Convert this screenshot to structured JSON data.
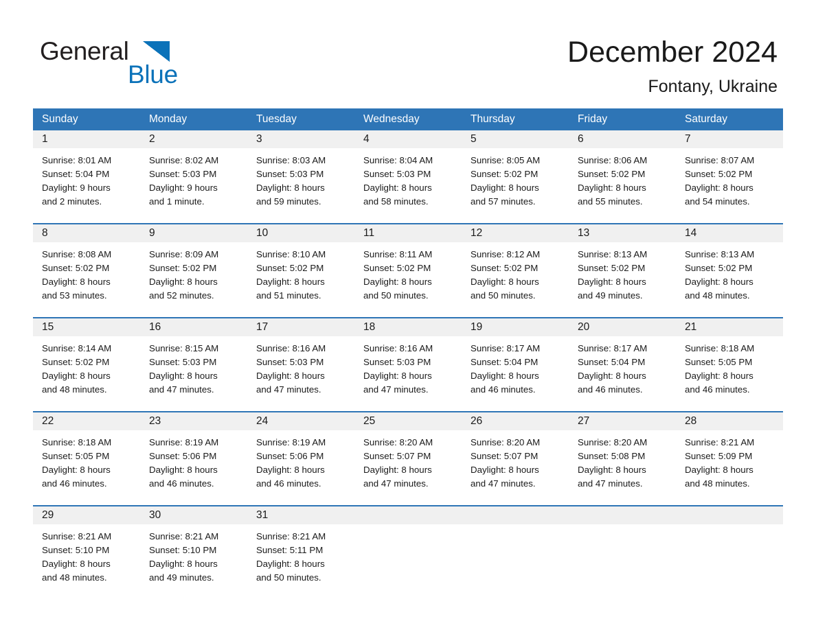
{
  "brand": {
    "name_part1": "General",
    "name_part2": "Blue",
    "triangle_icon": "blue-triangle-icon",
    "accent_color": "#0b72b9"
  },
  "header": {
    "title": "December 2024",
    "location": "Fontany, Ukraine"
  },
  "theme": {
    "header_band": "#2e75b6",
    "daynum_band": "#f0f0f0",
    "separator": "#2e75b6",
    "text": "#1a1a1a",
    "page_background": "#ffffff"
  },
  "calendar": {
    "weekday_headers": [
      "Sunday",
      "Monday",
      "Tuesday",
      "Wednesday",
      "Thursday",
      "Friday",
      "Saturday"
    ],
    "labels": {
      "sunrise_prefix": "Sunrise:",
      "sunset_prefix": "Sunset:",
      "daylight_prefix": "Daylight:"
    },
    "weeks": [
      {
        "days": [
          {
            "day": "1",
            "sunrise": "Sunrise: 8:01 AM",
            "sunset": "Sunset: 5:04 PM",
            "daylight_line1": "Daylight: 9 hours",
            "daylight_line2": "and 2 minutes."
          },
          {
            "day": "2",
            "sunrise": "Sunrise: 8:02 AM",
            "sunset": "Sunset: 5:03 PM",
            "daylight_line1": "Daylight: 9 hours",
            "daylight_line2": "and 1 minute."
          },
          {
            "day": "3",
            "sunrise": "Sunrise: 8:03 AM",
            "sunset": "Sunset: 5:03 PM",
            "daylight_line1": "Daylight: 8 hours",
            "daylight_line2": "and 59 minutes."
          },
          {
            "day": "4",
            "sunrise": "Sunrise: 8:04 AM",
            "sunset": "Sunset: 5:03 PM",
            "daylight_line1": "Daylight: 8 hours",
            "daylight_line2": "and 58 minutes."
          },
          {
            "day": "5",
            "sunrise": "Sunrise: 8:05 AM",
            "sunset": "Sunset: 5:02 PM",
            "daylight_line1": "Daylight: 8 hours",
            "daylight_line2": "and 57 minutes."
          },
          {
            "day": "6",
            "sunrise": "Sunrise: 8:06 AM",
            "sunset": "Sunset: 5:02 PM",
            "daylight_line1": "Daylight: 8 hours",
            "daylight_line2": "and 55 minutes."
          },
          {
            "day": "7",
            "sunrise": "Sunrise: 8:07 AM",
            "sunset": "Sunset: 5:02 PM",
            "daylight_line1": "Daylight: 8 hours",
            "daylight_line2": "and 54 minutes."
          }
        ]
      },
      {
        "days": [
          {
            "day": "8",
            "sunrise": "Sunrise: 8:08 AM",
            "sunset": "Sunset: 5:02 PM",
            "daylight_line1": "Daylight: 8 hours",
            "daylight_line2": "and 53 minutes."
          },
          {
            "day": "9",
            "sunrise": "Sunrise: 8:09 AM",
            "sunset": "Sunset: 5:02 PM",
            "daylight_line1": "Daylight: 8 hours",
            "daylight_line2": "and 52 minutes."
          },
          {
            "day": "10",
            "sunrise": "Sunrise: 8:10 AM",
            "sunset": "Sunset: 5:02 PM",
            "daylight_line1": "Daylight: 8 hours",
            "daylight_line2": "and 51 minutes."
          },
          {
            "day": "11",
            "sunrise": "Sunrise: 8:11 AM",
            "sunset": "Sunset: 5:02 PM",
            "daylight_line1": "Daylight: 8 hours",
            "daylight_line2": "and 50 minutes."
          },
          {
            "day": "12",
            "sunrise": "Sunrise: 8:12 AM",
            "sunset": "Sunset: 5:02 PM",
            "daylight_line1": "Daylight: 8 hours",
            "daylight_line2": "and 50 minutes."
          },
          {
            "day": "13",
            "sunrise": "Sunrise: 8:13 AM",
            "sunset": "Sunset: 5:02 PM",
            "daylight_line1": "Daylight: 8 hours",
            "daylight_line2": "and 49 minutes."
          },
          {
            "day": "14",
            "sunrise": "Sunrise: 8:13 AM",
            "sunset": "Sunset: 5:02 PM",
            "daylight_line1": "Daylight: 8 hours",
            "daylight_line2": "and 48 minutes."
          }
        ]
      },
      {
        "days": [
          {
            "day": "15",
            "sunrise": "Sunrise: 8:14 AM",
            "sunset": "Sunset: 5:02 PM",
            "daylight_line1": "Daylight: 8 hours",
            "daylight_line2": "and 48 minutes."
          },
          {
            "day": "16",
            "sunrise": "Sunrise: 8:15 AM",
            "sunset": "Sunset: 5:03 PM",
            "daylight_line1": "Daylight: 8 hours",
            "daylight_line2": "and 47 minutes."
          },
          {
            "day": "17",
            "sunrise": "Sunrise: 8:16 AM",
            "sunset": "Sunset: 5:03 PM",
            "daylight_line1": "Daylight: 8 hours",
            "daylight_line2": "and 47 minutes."
          },
          {
            "day": "18",
            "sunrise": "Sunrise: 8:16 AM",
            "sunset": "Sunset: 5:03 PM",
            "daylight_line1": "Daylight: 8 hours",
            "daylight_line2": "and 47 minutes."
          },
          {
            "day": "19",
            "sunrise": "Sunrise: 8:17 AM",
            "sunset": "Sunset: 5:04 PM",
            "daylight_line1": "Daylight: 8 hours",
            "daylight_line2": "and 46 minutes."
          },
          {
            "day": "20",
            "sunrise": "Sunrise: 8:17 AM",
            "sunset": "Sunset: 5:04 PM",
            "daylight_line1": "Daylight: 8 hours",
            "daylight_line2": "and 46 minutes."
          },
          {
            "day": "21",
            "sunrise": "Sunrise: 8:18 AM",
            "sunset": "Sunset: 5:05 PM",
            "daylight_line1": "Daylight: 8 hours",
            "daylight_line2": "and 46 minutes."
          }
        ]
      },
      {
        "days": [
          {
            "day": "22",
            "sunrise": "Sunrise: 8:18 AM",
            "sunset": "Sunset: 5:05 PM",
            "daylight_line1": "Daylight: 8 hours",
            "daylight_line2": "and 46 minutes."
          },
          {
            "day": "23",
            "sunrise": "Sunrise: 8:19 AM",
            "sunset": "Sunset: 5:06 PM",
            "daylight_line1": "Daylight: 8 hours",
            "daylight_line2": "and 46 minutes."
          },
          {
            "day": "24",
            "sunrise": "Sunrise: 8:19 AM",
            "sunset": "Sunset: 5:06 PM",
            "daylight_line1": "Daylight: 8 hours",
            "daylight_line2": "and 46 minutes."
          },
          {
            "day": "25",
            "sunrise": "Sunrise: 8:20 AM",
            "sunset": "Sunset: 5:07 PM",
            "daylight_line1": "Daylight: 8 hours",
            "daylight_line2": "and 47 minutes."
          },
          {
            "day": "26",
            "sunrise": "Sunrise: 8:20 AM",
            "sunset": "Sunset: 5:07 PM",
            "daylight_line1": "Daylight: 8 hours",
            "daylight_line2": "and 47 minutes."
          },
          {
            "day": "27",
            "sunrise": "Sunrise: 8:20 AM",
            "sunset": "Sunset: 5:08 PM",
            "daylight_line1": "Daylight: 8 hours",
            "daylight_line2": "and 47 minutes."
          },
          {
            "day": "28",
            "sunrise": "Sunrise: 8:21 AM",
            "sunset": "Sunset: 5:09 PM",
            "daylight_line1": "Daylight: 8 hours",
            "daylight_line2": "and 48 minutes."
          }
        ]
      },
      {
        "days": [
          {
            "day": "29",
            "sunrise": "Sunrise: 8:21 AM",
            "sunset": "Sunset: 5:10 PM",
            "daylight_line1": "Daylight: 8 hours",
            "daylight_line2": "and 48 minutes."
          },
          {
            "day": "30",
            "sunrise": "Sunrise: 8:21 AM",
            "sunset": "Sunset: 5:10 PM",
            "daylight_line1": "Daylight: 8 hours",
            "daylight_line2": "and 49 minutes."
          },
          {
            "day": "31",
            "sunrise": "Sunrise: 8:21 AM",
            "sunset": "Sunset: 5:11 PM",
            "daylight_line1": "Daylight: 8 hours",
            "daylight_line2": "and 50 minutes."
          },
          {
            "day": "",
            "sunrise": "",
            "sunset": "",
            "daylight_line1": "",
            "daylight_line2": ""
          },
          {
            "day": "",
            "sunrise": "",
            "sunset": "",
            "daylight_line1": "",
            "daylight_line2": ""
          },
          {
            "day": "",
            "sunrise": "",
            "sunset": "",
            "daylight_line1": "",
            "daylight_line2": ""
          },
          {
            "day": "",
            "sunrise": "",
            "sunset": "",
            "daylight_line1": "",
            "daylight_line2": ""
          }
        ]
      }
    ]
  }
}
